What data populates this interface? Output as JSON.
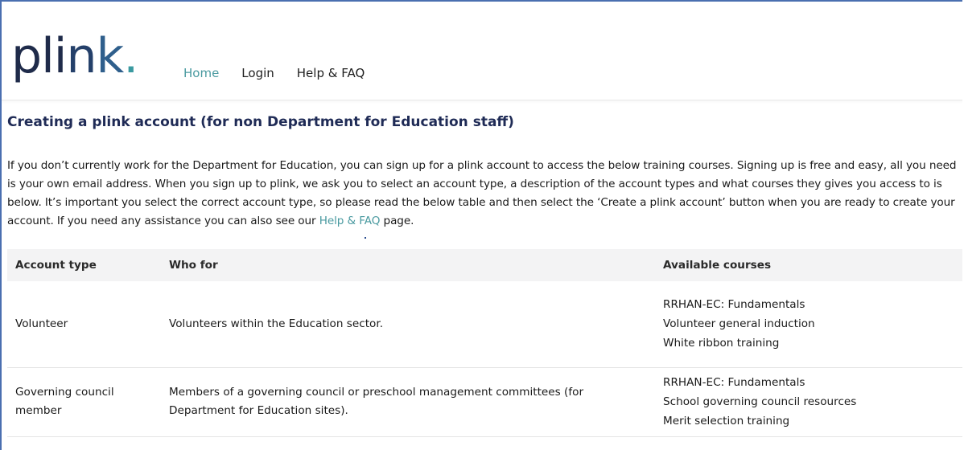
{
  "brand": {
    "logo_p": "pl",
    "logo_i": "i",
    "logo_n": "n",
    "logo_k": "k",
    "logo_dot": "."
  },
  "nav": {
    "items": [
      {
        "label": "Home",
        "active": true
      },
      {
        "label": "Login",
        "active": false
      },
      {
        "label": "Help & FAQ",
        "active": false
      }
    ]
  },
  "page": {
    "title": "Creating a plink account (for non Department for Education staff)",
    "intro_text": "If you don’t currently work for the Department for Education, you can sign up for a plink account to access the below training courses. Signing up is free and easy, all you need is your own email address. When you sign up to plink, we ask you to select an account type, a description of the account types and what courses they gives you access to is below. It’s important you select the correct account type, so please read the below table and then select the ‘Create a plink account’ button when you are ready to create your account. If you need any assistance you can also see our ",
    "intro_link": "Help & FAQ",
    "intro_end": " page."
  },
  "table": {
    "headers": [
      "Account type",
      "Who for",
      "Available courses"
    ],
    "rows": [
      {
        "type": "Volunteer",
        "who": "Volunteers within the Education sector.",
        "courses": [
          "RRHAN-EC: Fundamentals",
          "Volunteer general induction",
          "White ribbon training"
        ]
      },
      {
        "type": "Governing council member",
        "who": "Members of a governing council or preschool management committees (for Department for Education sites).",
        "courses": [
          "RRHAN-EC: Fundamentals",
          "School governing council resources",
          "Merit selection training"
        ]
      }
    ]
  },
  "colors": {
    "accent": "#4a9aa0",
    "heading": "#1f2b56",
    "frame_border": "#4a6fb0"
  }
}
